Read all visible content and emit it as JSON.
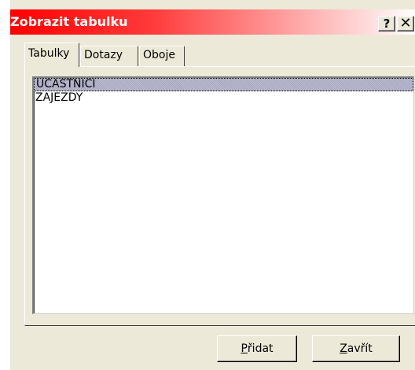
{
  "window": {
    "title": "Zobrazit tabulku",
    "help_label": "?",
    "close_label": "✕"
  },
  "tabs": [
    {
      "label": "Tabulky",
      "active": true
    },
    {
      "label": "Dotazy",
      "active": false
    },
    {
      "label": "Oboje",
      "active": false
    }
  ],
  "list": {
    "items": [
      {
        "label": "UCASTNICI",
        "selected": true
      },
      {
        "label": "ZAJEZDY",
        "selected": false
      }
    ]
  },
  "buttons": {
    "add_mnemonic": "P",
    "add_rest": "řidat",
    "close_mnemonic": "Z",
    "close_rest": "avřít"
  },
  "colors": {
    "title_gradient_start": "#ff0000",
    "face": "#ece9d8",
    "selection": "#a6a6c0"
  }
}
